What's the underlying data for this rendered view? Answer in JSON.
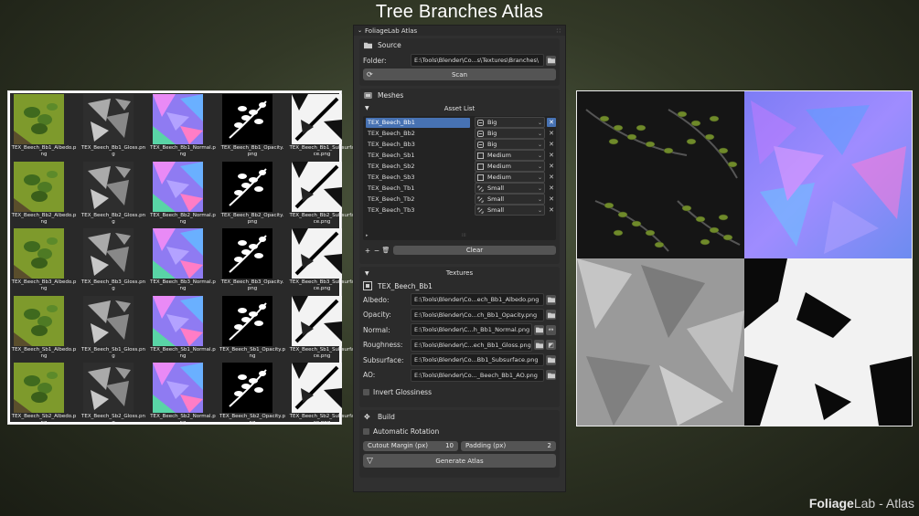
{
  "page_title": "Tree Branches Atlas",
  "brand": {
    "bold": "Foliage",
    "rest": "Lab - Atlas"
  },
  "colors": {
    "accent": "#4772b3",
    "panel": "#303030"
  },
  "texture_grid": {
    "rows": [
      [
        "TEX_Beech_Bb1_Albedo.png",
        "TEX_Beech_Bb1_Gloss.png",
        "TEX_Beech_Bb1_Normal.png",
        "TEX_Beech_Bb1_Opacity.png",
        "TEX_Beech_Bb1_Subsurface.png"
      ],
      [
        "TEX_Beech_Bb2_Albedo.png",
        "TEX_Beech_Bb2_Gloss.png",
        "TEX_Beech_Bb2_Normal.png",
        "TEX_Beech_Bb2_Opacity.png",
        "TEX_Beech_Bb2_Subsurface.png"
      ],
      [
        "TEX_Beech_Bb3_Albedo.png",
        "TEX_Beech_Bb3_Gloss.png",
        "TEX_Beech_Bb3_Normal.png",
        "TEX_Beech_Bb3_Opacity.png",
        "TEX_Beech_Bb3_Subsurface.png"
      ],
      [
        "TEX_Beech_Sb1_Albedo.png",
        "TEX_Beech_Sb1_Gloss.png",
        "TEX_Beech_Sb1_Normal.png",
        "TEX_Beech_Sb1_Opacity.png",
        "TEX_Beech_Sb1_Subsurface.png"
      ],
      [
        "TEX_Beech_Sb2_Albedo.png",
        "TEX_Beech_Sb2_Gloss.png",
        "TEX_Beech_Sb2_Normal.png",
        "TEX_Beech_Sb2_Opacity.png",
        "TEX_Beech_Sb2_Subsurface.png"
      ]
    ]
  },
  "panel": {
    "title": "FoliageLab Atlas",
    "source": {
      "header": "Source",
      "folder_label": "Folder:",
      "folder_value": "E:\\Tools\\Blender\\Co...s\\Textures\\Branches\\",
      "scan_label": "Scan"
    },
    "meshes": {
      "header": "Meshes",
      "asset_list_header": "Asset List",
      "assets": [
        {
          "name": "TEX_Beech_Bb1",
          "size": "Big",
          "size_icon": "big-size-icon",
          "selected": true
        },
        {
          "name": "TEX_Beech_Bb2",
          "size": "Big",
          "size_icon": "big-size-icon",
          "selected": false
        },
        {
          "name": "TEX_Beech_Bb3",
          "size": "Big",
          "size_icon": "big-size-icon",
          "selected": false
        },
        {
          "name": "TEX_Beech_Sb1",
          "size": "Medium",
          "size_icon": "medium-size-icon",
          "selected": false
        },
        {
          "name": "TEX_Beech_Sb2",
          "size": "Medium",
          "size_icon": "medium-size-icon",
          "selected": false
        },
        {
          "name": "TEX_Beech_Sb3",
          "size": "Medium",
          "size_icon": "medium-size-icon",
          "selected": false
        },
        {
          "name": "TEX_Beech_Tb1",
          "size": "Small",
          "size_icon": "small-size-icon",
          "selected": false
        },
        {
          "name": "TEX_Beech_Tb2",
          "size": "Small",
          "size_icon": "small-size-icon",
          "selected": false
        },
        {
          "name": "TEX_Beech_Tb3",
          "size": "Small",
          "size_icon": "small-size-icon",
          "selected": false
        }
      ],
      "clear_label": "Clear"
    },
    "textures": {
      "header": "Textures",
      "selected_asset": "TEX_Beech_Bb1",
      "fields": [
        {
          "label": "Albedo:",
          "value": "E:\\Tools\\Blender\\Co...ech_Bb1_Albedo.png",
          "extra": false
        },
        {
          "label": "Opacity:",
          "value": "E:\\Tools\\Blender\\Co...ch_Bb1_Opacity.png",
          "extra": false
        },
        {
          "label": "Normal:",
          "value": "E:\\Tools\\Blender\\C...h_Bb1_Normal.png",
          "extra": true
        },
        {
          "label": "Roughness:",
          "value": "E:\\Tools\\Blender\\C...ech_Bb1_Gloss.png",
          "extra": true
        },
        {
          "label": "Subsurface:",
          "value": "E:\\Tools\\Blender\\Co...Bb1_Subsurface.png",
          "extra": false
        },
        {
          "label": "AO:",
          "value": "E:\\Tools\\Blender\\Co..._Beech_Bb1_AO.png",
          "extra": false
        }
      ],
      "invert_glossiness_label": "Invert Glossiness"
    },
    "build": {
      "header": "Build",
      "auto_rotation_label": "Automatic Rotation",
      "cutout_margin_label": "Cutout Margin (px)",
      "cutout_margin_value": "10",
      "padding_label": "Padding (px)",
      "padding_value": "2",
      "generate_label": "Generate Atlas"
    }
  }
}
